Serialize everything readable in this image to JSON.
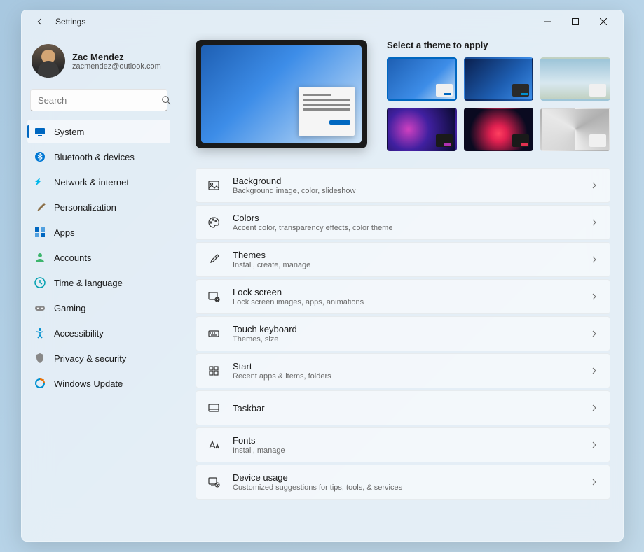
{
  "window_title": "Settings",
  "user": {
    "name": "Zac Mendez",
    "email": "zacmendez@outlook.com"
  },
  "search": {
    "placeholder": "Search"
  },
  "sidebar": {
    "items": [
      {
        "label": "System"
      },
      {
        "label": "Bluetooth & devices"
      },
      {
        "label": "Network & internet"
      },
      {
        "label": "Personalization"
      },
      {
        "label": "Apps"
      },
      {
        "label": "Accounts"
      },
      {
        "label": "Time & language"
      },
      {
        "label": "Gaming"
      },
      {
        "label": "Accessibility"
      },
      {
        "label": "Privacy & security"
      },
      {
        "label": "Windows Update"
      }
    ],
    "active_index": 0
  },
  "themes_heading": "Select a theme to apply",
  "settings": [
    {
      "title": "Background",
      "sub": "Background image, color, slideshow"
    },
    {
      "title": "Colors",
      "sub": "Accent color, transparency effects, color theme"
    },
    {
      "title": "Themes",
      "sub": "Install, create, manage"
    },
    {
      "title": "Lock screen",
      "sub": "Lock screen images, apps, animations"
    },
    {
      "title": "Touch keyboard",
      "sub": "Themes, size"
    },
    {
      "title": "Start",
      "sub": "Recent apps & items, folders"
    },
    {
      "title": "Taskbar",
      "sub": ""
    },
    {
      "title": "Fonts",
      "sub": "Install, manage"
    },
    {
      "title": "Device usage",
      "sub": "Customized suggestions for tips, tools, & services"
    }
  ]
}
